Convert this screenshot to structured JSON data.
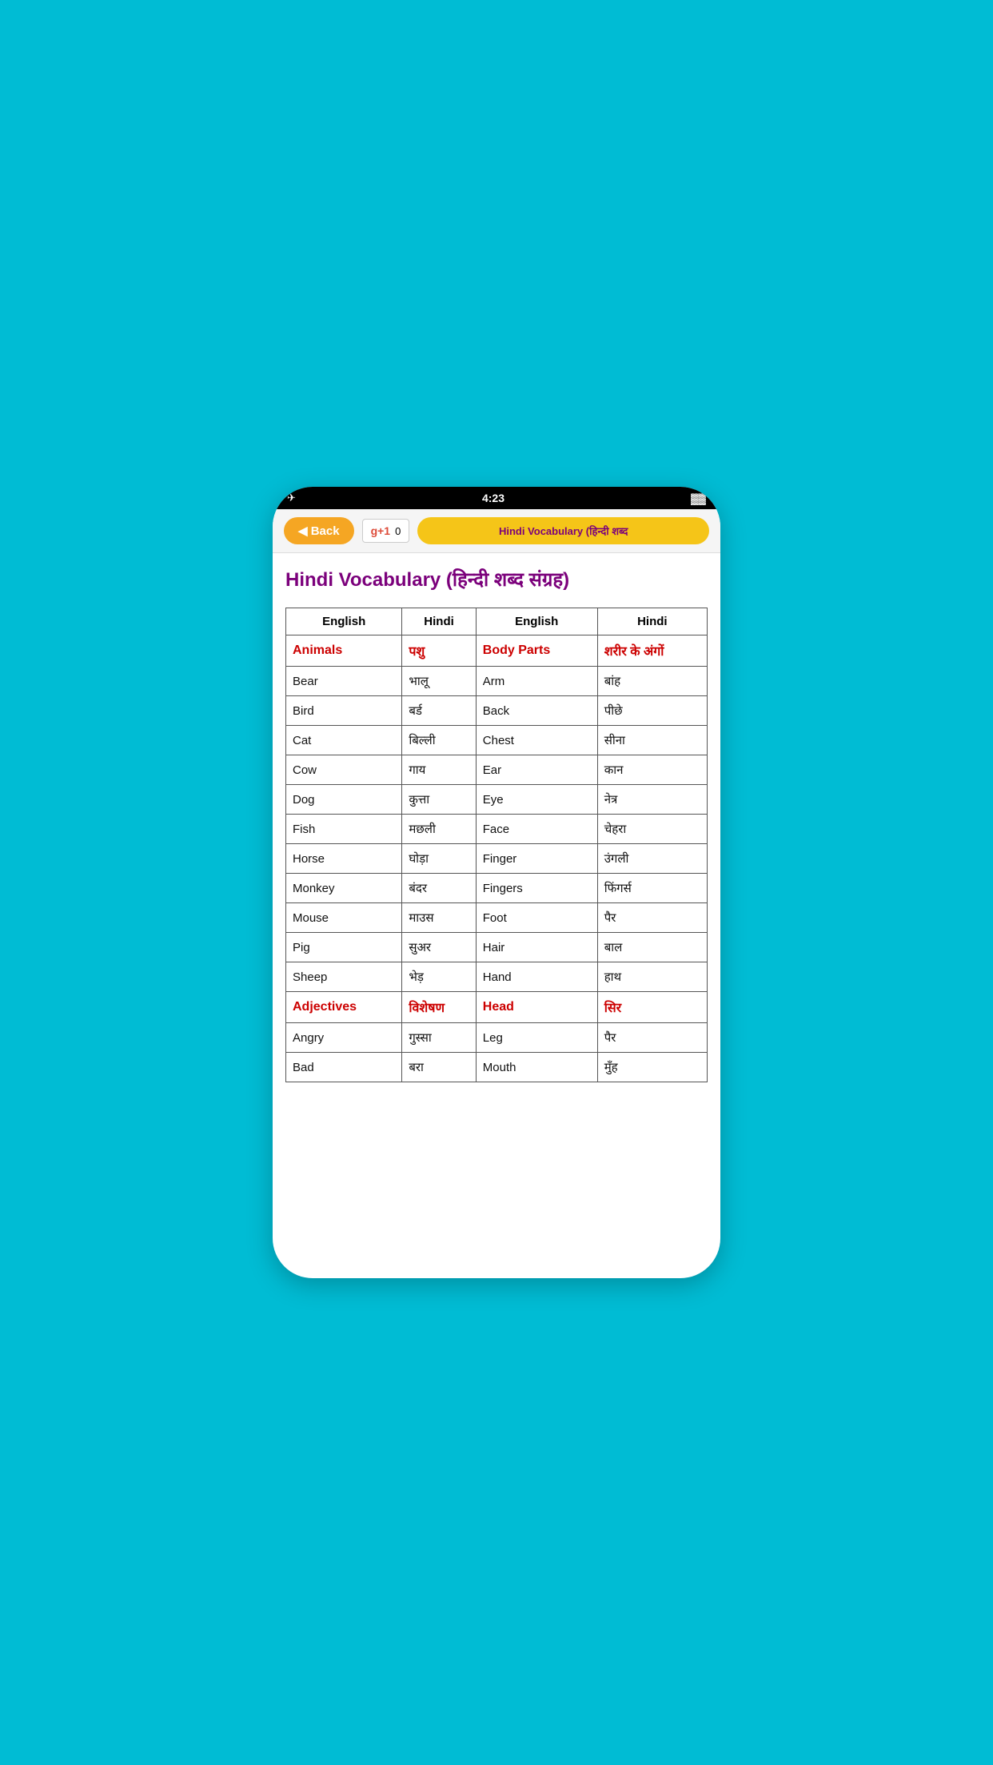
{
  "statusBar": {
    "time": "4:23",
    "leftIcon": "✈",
    "batteryIcon": "🔋"
  },
  "navBar": {
    "backLabel": "◀ Back",
    "gplusLabel": "g+1",
    "gplusCount": "0",
    "vocabBtnLabel": "Hindi Vocabulary (हिन्दी शब्द"
  },
  "pageTitle": "Hindi Vocabulary (हिन्दी शब्द संग्रह)",
  "tableHeaders": [
    "English",
    "Hindi",
    "English",
    "Hindi"
  ],
  "tableRows": [
    {
      "type": "category",
      "col1": "Animals",
      "col2": "पशु",
      "col3": "Body Parts",
      "col4": "शरीर के अंगों"
    },
    {
      "type": "data",
      "col1": "Bear",
      "col2": "भालू",
      "col3": "Arm",
      "col4": "बांह"
    },
    {
      "type": "data",
      "col1": "Bird",
      "col2": "बर्ड",
      "col3": "Back",
      "col4": "पीछे"
    },
    {
      "type": "data",
      "col1": "Cat",
      "col2": "बिल्ली",
      "col3": "Chest",
      "col4": "सीना"
    },
    {
      "type": "data",
      "col1": "Cow",
      "col2": "गाय",
      "col3": "Ear",
      "col4": "कान"
    },
    {
      "type": "data",
      "col1": "Dog",
      "col2": "कुत्ता",
      "col3": "Eye",
      "col4": "नेत्र"
    },
    {
      "type": "data",
      "col1": "Fish",
      "col2": "मछली",
      "col3": "Face",
      "col4": "चेहरा"
    },
    {
      "type": "data",
      "col1": "Horse",
      "col2": "घोड़ा",
      "col3": "Finger",
      "col4": "उंगली"
    },
    {
      "type": "data",
      "col1": "Monkey",
      "col2": "बंदर",
      "col3": "Fingers",
      "col4": "फिंगर्स"
    },
    {
      "type": "data",
      "col1": "Mouse",
      "col2": "माउस",
      "col3": "Foot",
      "col4": "पैर"
    },
    {
      "type": "data",
      "col1": "Pig",
      "col2": "सुअर",
      "col3": "Hair",
      "col4": "बाल"
    },
    {
      "type": "data",
      "col1": "Sheep",
      "col2": "भेड़",
      "col3": "Hand",
      "col4": "हाथ"
    },
    {
      "type": "category",
      "col1": "Adjectives",
      "col2": "विशेषण",
      "col3": "Head",
      "col4": "सिर"
    },
    {
      "type": "data",
      "col1": "Angry",
      "col2": "गुस्सा",
      "col3": "Leg",
      "col4": "पैर"
    },
    {
      "type": "data",
      "col1": "Bad",
      "col2": "बरा",
      "col3": "Mouth",
      "col4": "मुँह"
    }
  ]
}
